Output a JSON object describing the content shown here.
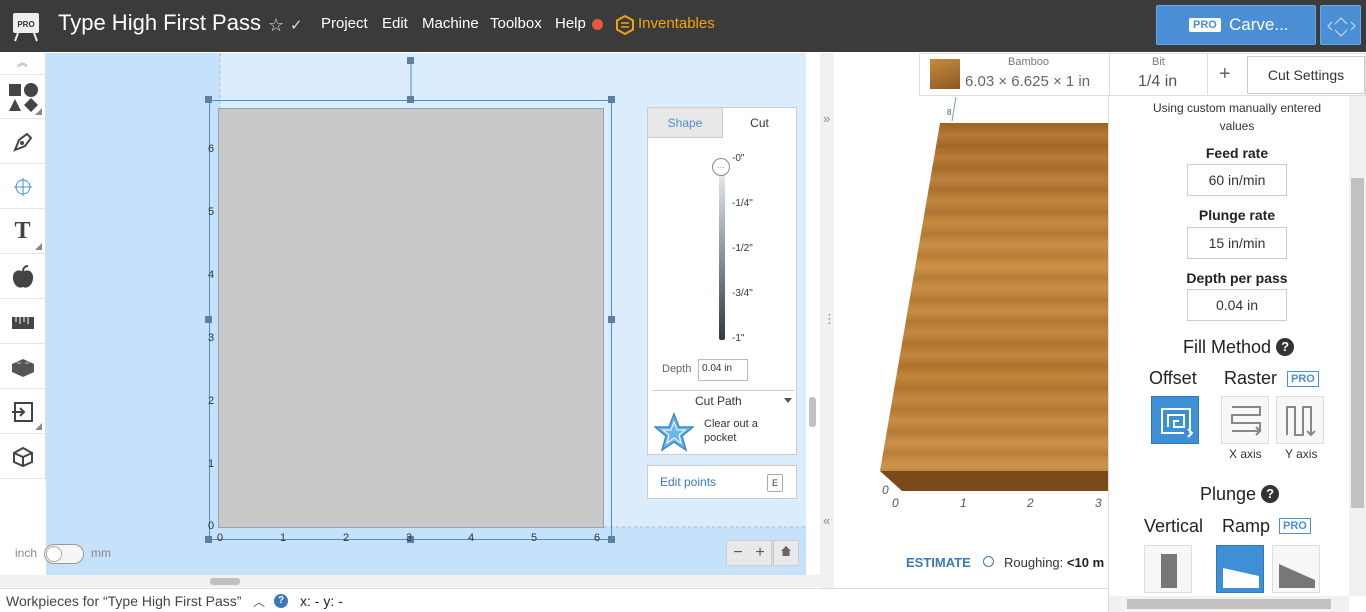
{
  "header": {
    "title": "Type High First Pass",
    "menu": [
      "Project",
      "Edit",
      "Machine",
      "Toolbox",
      "Help"
    ],
    "inventables_label": "Inventables",
    "pro_badge": "PRO",
    "carve_label": "Carve...",
    "accent": "#4a8fd6",
    "status_dot_color": "#e8553c"
  },
  "toolbar": {
    "tools": [
      "shapes-icon",
      "pen-icon",
      "point-icon",
      "text-icon",
      "apple-icon",
      "ruler-icon",
      "brick-icon",
      "import-icon",
      "box-icon"
    ]
  },
  "canvas": {
    "x_ticks": [
      "0",
      "1",
      "2",
      "3",
      "4",
      "5",
      "6"
    ],
    "y_ticks": [
      "6",
      "5",
      "4",
      "3",
      "2",
      "1",
      "0"
    ],
    "unit_left": "inch",
    "unit_right": "mm",
    "zoom_out": "−",
    "zoom_in": "+"
  },
  "inspector": {
    "tab_shape": "Shape",
    "tab_cut": "Cut",
    "depth_knob": "...",
    "depth_ticks": [
      "-0\"",
      "-1/4\"",
      "-1/2\"",
      "-3/4\"",
      "-1\""
    ],
    "depth_label": "Depth",
    "depth_value": "0.04 in",
    "cut_path_label": "Cut Path",
    "pocket_label": "Clear out a pocket",
    "edit_points_label": "Edit points",
    "edit_points_key": "E"
  },
  "material": {
    "name": "Bamboo",
    "dims": "6.03 × 6.625 × 1 in",
    "bit_label": "Bit",
    "bit_value": "1/4 in",
    "add": "+",
    "cut_settings_label": "Cut Settings"
  },
  "preview": {
    "x_ticks": [
      "0",
      "1",
      "2",
      "3"
    ],
    "origin_label": "0",
    "bit_corner": "8",
    "estimate_label": "ESTIMATE",
    "roughing_label": "Roughing:",
    "roughing_value": "<10 m"
  },
  "cut_settings": {
    "note": "Using custom manually entered values",
    "feed_rate_label": "Feed rate",
    "feed_rate": "60 in/min",
    "plunge_rate_label": "Plunge rate",
    "plunge_rate": "15 in/min",
    "depth_per_pass_label": "Depth per pass",
    "depth_per_pass": "0.04 in",
    "fill_method_label": "Fill Method",
    "offset_label": "Offset",
    "raster_label": "Raster",
    "pro": "PRO",
    "x_axis": "X axis",
    "y_axis": "Y axis",
    "plunge_label": "Plunge",
    "vertical_label": "Vertical",
    "ramp_label": "Ramp",
    "help": "?"
  },
  "statusbar": {
    "workpieces_label": "Workpieces for “Type High First Pass”",
    "help": "?",
    "coords": "x: - y: -"
  }
}
